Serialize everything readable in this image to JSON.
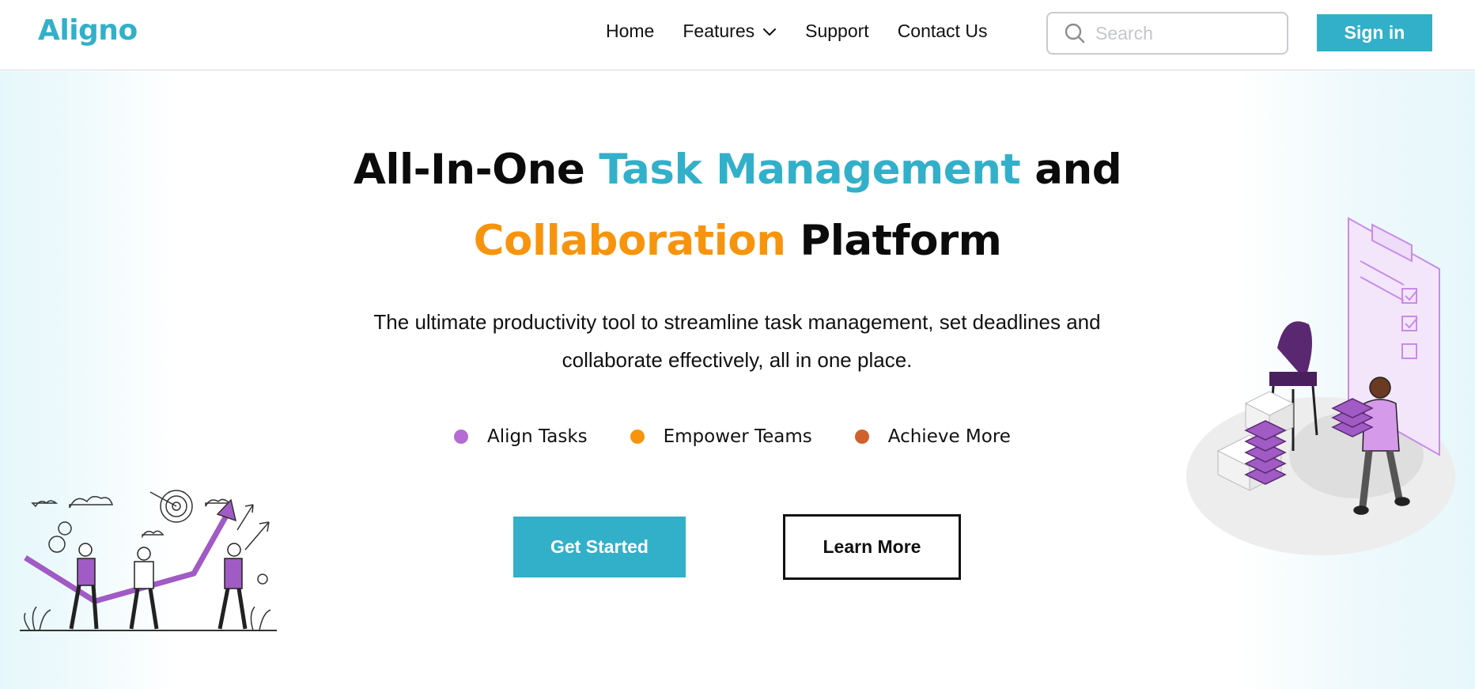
{
  "nav": {
    "logo": "Aligno",
    "links": [
      "Home",
      "Features",
      "Support",
      "Contact Us"
    ],
    "search_placeholder": "Search",
    "signin_label": "Sign in"
  },
  "hero": {
    "headline": {
      "line1_a": "All-In-One ",
      "line1_b": "Task Management",
      "line1_c": " and",
      "line2_a": "Collaboration",
      "line2_b": " Platform"
    },
    "subtitle_line1": "The ultimate productivity tool to streamline task management, set deadlines and",
    "subtitle_line2": "collaborate effectively, all in one place.",
    "bullets": [
      {
        "label": "Align Tasks",
        "color": "#b56bd3"
      },
      {
        "label": "Empower Teams",
        "color": "#f7940e"
      },
      {
        "label": "Achieve More",
        "color": "#d0612d"
      }
    ],
    "primary_cta": "Get Started",
    "secondary_cta": "Learn More"
  },
  "colors": {
    "brand_teal": "#32b0c9",
    "accent_orange": "#f7940e",
    "illustration_purple": "#a05bc4"
  },
  "icons": {
    "search": "search-icon",
    "features_dropdown": "chevron-down-icon",
    "left_illustration": "team-growth-illustration",
    "right_illustration": "checklist-woman-illustration"
  }
}
